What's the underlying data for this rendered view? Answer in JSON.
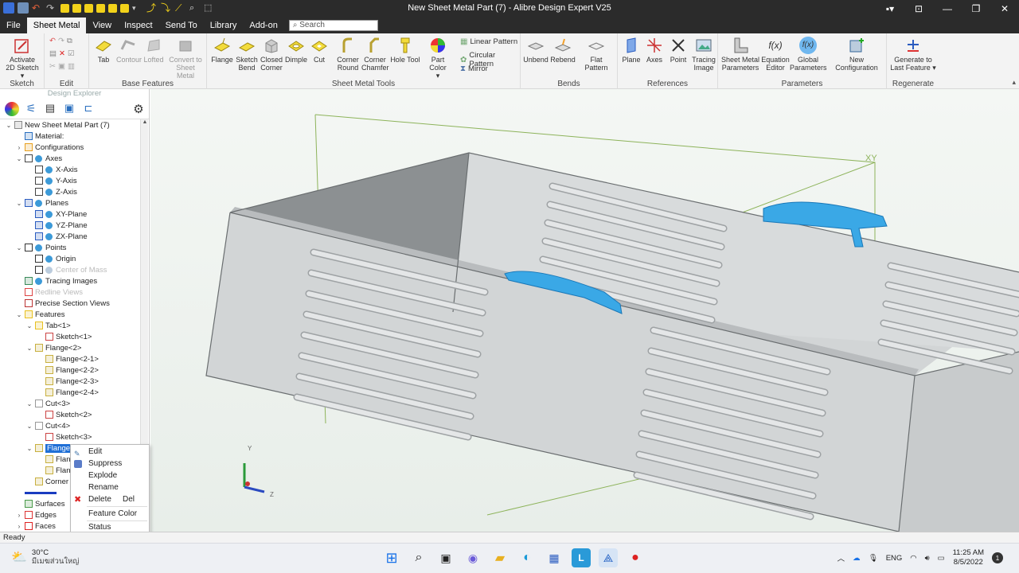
{
  "window": {
    "title": "New Sheet Metal Part (7) - Alibre Design Expert V25",
    "minimize": "—",
    "restore": "❐",
    "close": "✕"
  },
  "menu": {
    "tabs": [
      "File",
      "Sheet Metal",
      "View",
      "Inspect",
      "Send To",
      "Library",
      "Add-on"
    ],
    "search_placeholder": "Search"
  },
  "ribbon": {
    "groups": {
      "sketch": "Sketch",
      "edit": "Edit",
      "base_features": "Base Features",
      "sheet_metal_tools": "Sheet Metal Tools",
      "bends": "Bends",
      "references": "References",
      "parameters": "Parameters",
      "regenerate": "Regenerate"
    },
    "buttons": {
      "activate_sketch_1": "Activate",
      "activate_sketch_2": "2D Sketch ▾",
      "tab": "Tab",
      "contour": "Contour",
      "lofted": "Lofted",
      "convert_1": "Convert to",
      "convert_2": "Sheet Metal",
      "flange": "Flange",
      "sketch_bend_1": "Sketch",
      "sketch_bend_2": "Bend",
      "closed_corner_1": "Closed",
      "closed_corner_2": "Corner",
      "dimple": "Dimple",
      "cut": "Cut",
      "corner_round_1": "Corner",
      "corner_round_2": "Round",
      "corner_chamfer_1": "Corner",
      "corner_chamfer_2": "Chamfer",
      "hole_tool": "Hole Tool",
      "part_color": "Part Color",
      "part_color_arrow": "▾",
      "linear_pattern": "Linear Pattern",
      "circular_pattern": "Circular Pattern",
      "mirror": "Mirror",
      "unbend": "Unbend",
      "rebend": "Rebend",
      "flat_pattern": "Flat Pattern",
      "plane": "Plane",
      "axes": "Axes",
      "point": "Point",
      "tracing_image_1": "Tracing",
      "tracing_image_2": "Image",
      "sm_params_1": "Sheet Metal",
      "sm_params_2": "Parameters",
      "equation_1": "Equation",
      "equation_2": "Editor",
      "global_params_1": "Global",
      "global_params_2": "Parameters",
      "new_configuration": "New Configuration",
      "generate_1": "Generate to",
      "generate_2": "Last Feature ▾"
    }
  },
  "explorer": {
    "title": "Design Explorer",
    "tree": [
      {
        "label": "New Sheet Metal Part (7)",
        "level": 0,
        "twisty": "⌄",
        "icon": "part-icon",
        "eye": false,
        "dim": false,
        "sel": false
      },
      {
        "label": "Material:",
        "level": 1,
        "twisty": "",
        "icon": "material-icon",
        "eye": false,
        "dim": false,
        "sel": false
      },
      {
        "label": "Configurations",
        "level": 1,
        "twisty": "›",
        "icon": "configurations-icon",
        "eye": false,
        "dim": false,
        "sel": false
      },
      {
        "label": "Axes",
        "level": 1,
        "twisty": "⌄",
        "icon": "axes-icon",
        "eye": true,
        "dim": false,
        "sel": false
      },
      {
        "label": "X-Axis",
        "level": 2,
        "twisty": "",
        "icon": "axis-icon",
        "eye": true,
        "dim": false,
        "sel": false
      },
      {
        "label": "Y-Axis",
        "level": 2,
        "twisty": "",
        "icon": "axis-icon",
        "eye": true,
        "dim": false,
        "sel": false
      },
      {
        "label": "Z-Axis",
        "level": 2,
        "twisty": "",
        "icon": "axis-icon",
        "eye": true,
        "dim": false,
        "sel": false
      },
      {
        "label": "Planes",
        "level": 1,
        "twisty": "⌄",
        "icon": "planes-icon",
        "eye": true,
        "dim": false,
        "sel": false
      },
      {
        "label": "XY-Plane",
        "level": 2,
        "twisty": "",
        "icon": "plane-icon",
        "eye": true,
        "dim": false,
        "sel": false
      },
      {
        "label": "YZ-Plane",
        "level": 2,
        "twisty": "",
        "icon": "plane-icon",
        "eye": true,
        "dim": false,
        "sel": false
      },
      {
        "label": "ZX-Plane",
        "level": 2,
        "twisty": "",
        "icon": "plane-icon",
        "eye": true,
        "dim": false,
        "sel": false
      },
      {
        "label": "Points",
        "level": 1,
        "twisty": "⌄",
        "icon": "points-icon",
        "eye": true,
        "dim": false,
        "sel": false
      },
      {
        "label": "Origin",
        "level": 2,
        "twisty": "",
        "icon": "point-icon",
        "eye": true,
        "dim": false,
        "sel": false
      },
      {
        "label": "Center of Mass",
        "level": 2,
        "twisty": "",
        "icon": "point-icon",
        "eye": true,
        "dim": true,
        "sel": false
      },
      {
        "label": "Tracing Images",
        "level": 1,
        "twisty": "",
        "icon": "tracing-icon",
        "eye": true,
        "dim": false,
        "sel": false
      },
      {
        "label": "Redline Views",
        "level": 1,
        "twisty": "",
        "icon": "redline-icon",
        "eye": false,
        "dim": true,
        "sel": false
      },
      {
        "label": "Precise Section Views",
        "level": 1,
        "twisty": "",
        "icon": "section-icon",
        "eye": false,
        "dim": false,
        "sel": false
      },
      {
        "label": "Features",
        "level": 1,
        "twisty": "⌄",
        "icon": "features-icon",
        "eye": false,
        "dim": false,
        "sel": false
      },
      {
        "label": "Tab<1>",
        "level": 2,
        "twisty": "⌄",
        "icon": "tab-icon",
        "eye": false,
        "dim": false,
        "sel": false
      },
      {
        "label": "Sketch<1>",
        "level": 3,
        "twisty": "",
        "icon": "sketch-icon",
        "eye": false,
        "dim": false,
        "sel": false
      },
      {
        "label": "Flange<2>",
        "level": 2,
        "twisty": "⌄",
        "icon": "flange-icon",
        "eye": false,
        "dim": false,
        "sel": false
      },
      {
        "label": "Flange<2-1>",
        "level": 3,
        "twisty": "",
        "icon": "flange-icon",
        "eye": false,
        "dim": false,
        "sel": false
      },
      {
        "label": "Flange<2-2>",
        "level": 3,
        "twisty": "",
        "icon": "flange-icon",
        "eye": false,
        "dim": false,
        "sel": false
      },
      {
        "label": "Flange<2-3>",
        "level": 3,
        "twisty": "",
        "icon": "flange-icon",
        "eye": false,
        "dim": false,
        "sel": false
      },
      {
        "label": "Flange<2-4>",
        "level": 3,
        "twisty": "",
        "icon": "flange-icon",
        "eye": false,
        "dim": false,
        "sel": false
      },
      {
        "label": "Cut<3>",
        "level": 2,
        "twisty": "⌄",
        "icon": "cut-icon",
        "eye": false,
        "dim": false,
        "sel": false
      },
      {
        "label": "Sketch<2>",
        "level": 3,
        "twisty": "",
        "icon": "sketch-icon",
        "eye": false,
        "dim": false,
        "sel": false
      },
      {
        "label": "Cut<4>",
        "level": 2,
        "twisty": "⌄",
        "icon": "cut-icon",
        "eye": false,
        "dim": false,
        "sel": false
      },
      {
        "label": "Sketch<3>",
        "level": 3,
        "twisty": "",
        "icon": "sketch-icon",
        "eye": false,
        "dim": false,
        "sel": false
      },
      {
        "label": "Flange<5>",
        "level": 2,
        "twisty": "⌄",
        "icon": "flange-icon",
        "eye": false,
        "dim": false,
        "sel": true
      },
      {
        "label": "Flange",
        "level": 3,
        "twisty": "",
        "icon": "flange-icon",
        "eye": false,
        "dim": false,
        "sel": false
      },
      {
        "label": "Flange",
        "level": 3,
        "twisty": "",
        "icon": "flange-icon",
        "eye": false,
        "dim": false,
        "sel": false
      },
      {
        "label": "Corner R",
        "level": 2,
        "twisty": "",
        "icon": "corner-icon",
        "eye": false,
        "dim": false,
        "sel": false
      },
      {
        "label": "",
        "level": 1,
        "twisty": "",
        "icon": "rollback-bar-icon",
        "eye": false,
        "dim": false,
        "sel": false
      },
      {
        "label": "Surfaces",
        "level": 1,
        "twisty": "",
        "icon": "surfaces-icon",
        "eye": false,
        "dim": false,
        "sel": false
      },
      {
        "label": "Edges",
        "level": 1,
        "twisty": "›",
        "icon": "edges-icon",
        "eye": false,
        "dim": false,
        "sel": false
      },
      {
        "label": "Faces",
        "level": 1,
        "twisty": "›",
        "icon": "faces-icon",
        "eye": false,
        "dim": false,
        "sel": false
      }
    ]
  },
  "context_menu": {
    "items": [
      {
        "label": "Edit",
        "shortcut": ""
      },
      {
        "label": "Suppress",
        "shortcut": ""
      },
      {
        "label": "Explode",
        "shortcut": ""
      },
      {
        "label": "Rename",
        "shortcut": ""
      },
      {
        "label": "Delete",
        "shortcut": "Del"
      },
      {
        "label": "Feature Color",
        "shortcut": ""
      },
      {
        "label": "Status",
        "shortcut": ""
      }
    ]
  },
  "viewport": {
    "plane_label": "XY",
    "triad": {
      "y": "Y",
      "z": "Z"
    },
    "colors": {
      "part": "#d2d5d6",
      "part_edge": "#6a6e70",
      "highlight": "#3aa8e6",
      "plane_line": "#8db35a"
    }
  },
  "statusbar": {
    "text": "Ready"
  },
  "taskbar": {
    "temperature": "30°C",
    "weather_location": "มีเมฆส่วนใหญ่",
    "language": "ENG",
    "time": "11:25 AM",
    "date": "8/5/2022",
    "notification_count": "1"
  }
}
